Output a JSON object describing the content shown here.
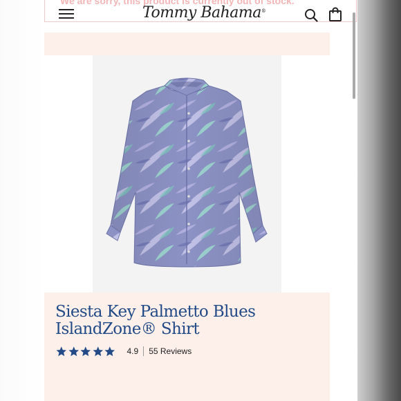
{
  "banner": {
    "message": "We are sorry, this product is currently out of stock."
  },
  "header": {
    "brand": "Tommy Bahama",
    "brand_mark": "®",
    "menu_icon": "hamburger-menu-icon",
    "search_icon": "search-icon",
    "bag_icon": "shopping-bag-icon"
  },
  "product": {
    "title": "Siesta Key Palmetto Blues IslandZone® Shirt",
    "rating": "4.9",
    "reviews": "55 Reviews",
    "star_count": 5,
    "star_color": "#224a86"
  },
  "colors": {
    "title_color": "#224a86",
    "promo_bg": "#fdf0ea",
    "banner_text": "#f2b6b6"
  }
}
